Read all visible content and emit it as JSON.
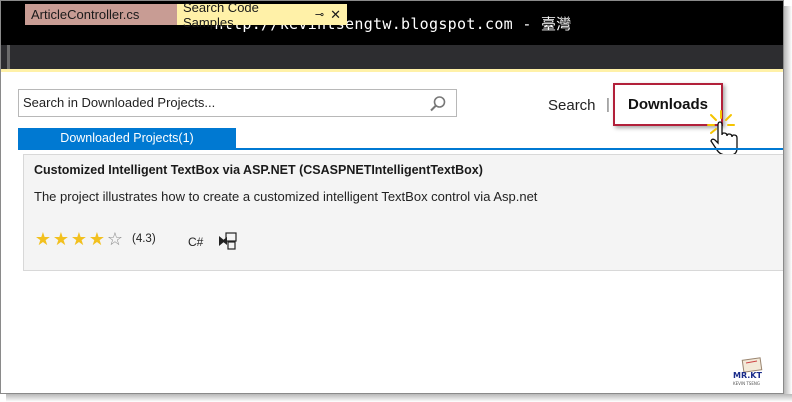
{
  "banner": {
    "text": "http://kevintsengtw.blogspot.com - 臺灣"
  },
  "tabs": [
    {
      "label": "ArticleController.cs",
      "active": false
    },
    {
      "label": "Search Code Samples",
      "active": true,
      "pin_glyph": "⊸",
      "close_glyph": "✕"
    }
  ],
  "search": {
    "placeholder": "Search in Downloaded Projects...",
    "value": ""
  },
  "nav": {
    "search_label": "Search",
    "separator": "|",
    "downloads_label": "Downloads"
  },
  "section_tab": {
    "label": "Downloaded Projects(1)"
  },
  "project": {
    "title": "Customized Intelligent TextBox via ASP.NET (CSASPNETIntelligentTextBox)",
    "description": "The project illustrates how to create a customized intelligent TextBox control via Asp.net",
    "rating_stars": 4,
    "rating_max": 5,
    "rating_text": "(4.3)",
    "language": "C#",
    "project_type_icon": "visual-studio-project-icon"
  },
  "logo": {
    "text": "MR.KT",
    "subtext": "KEVIN TSENG"
  },
  "colors": {
    "accent_blue": "#0079d2",
    "active_tab": "#fff1a8",
    "inactive_tab": "#c89c94",
    "highlight_border": "#b2203a",
    "star_on": "#f2c01e"
  }
}
